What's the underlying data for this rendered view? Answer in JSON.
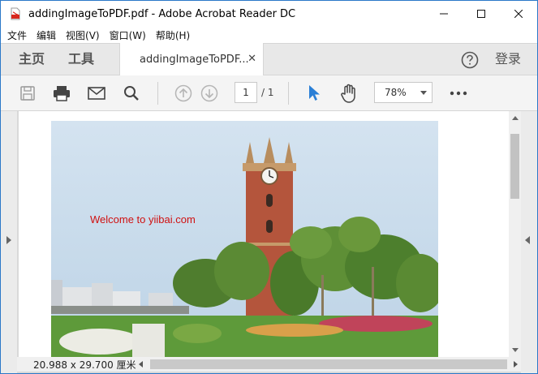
{
  "window": {
    "title": "addingImageToPDF.pdf - Adobe Acrobat Reader DC",
    "controls": [
      "minimize",
      "maximize",
      "close"
    ]
  },
  "menu": {
    "items": [
      "文件",
      "编辑",
      "视图(V)",
      "窗口(W)",
      "帮助(H)"
    ]
  },
  "tabs": {
    "home": "主页",
    "tools": "工具",
    "document": "addingImageToPDF...",
    "signin": "登录"
  },
  "toolbar": {
    "page_current": "1",
    "page_total": "/ 1",
    "zoom": "78%"
  },
  "document": {
    "overlay_text": "Welcome to yiibai.com",
    "overlay_color": "#d01010"
  },
  "status": {
    "page_size": "20.988 x 29.700 厘米"
  },
  "colors": {
    "accent_blue": "#2a7fd6",
    "window_border": "#2b78c8"
  }
}
